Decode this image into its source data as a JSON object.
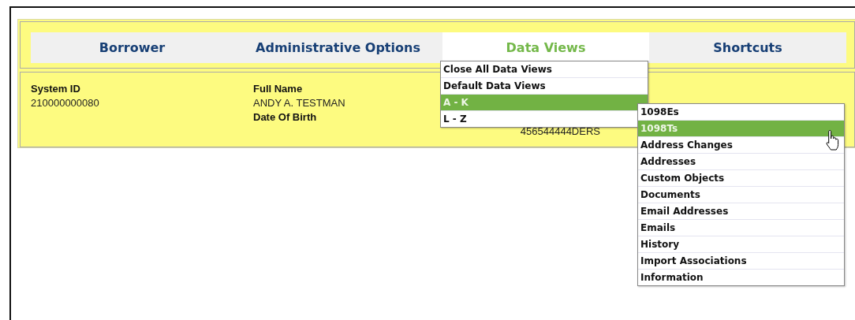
{
  "tabs": [
    {
      "label": "Borrower",
      "selected": false
    },
    {
      "label": "Administrative Options",
      "selected": false
    },
    {
      "label": "Data Views",
      "selected": true
    },
    {
      "label": "Shortcuts",
      "selected": false
    }
  ],
  "info_columns": [
    [
      {
        "kind": "label",
        "text": "System ID"
      },
      {
        "kind": "value",
        "text": "210000000080"
      }
    ],
    [
      {
        "kind": "label",
        "text": "Full Name"
      },
      {
        "kind": "value",
        "text": "ANDY A. TESTMAN"
      },
      {
        "kind": "label",
        "text": "Date Of Birth"
      }
    ],
    [
      {
        "kind": "value",
        "text": "456544444DERS"
      }
    ]
  ],
  "data_views_menu": [
    {
      "label": "Close All Data Views",
      "selected": false
    },
    {
      "label": "Default Data Views",
      "selected": false
    },
    {
      "label": "A - K",
      "selected": true
    },
    {
      "label": "L - Z",
      "selected": false
    }
  ],
  "submenu": [
    {
      "label": "1098Es",
      "selected": false
    },
    {
      "label": "1098Ts",
      "selected": true
    },
    {
      "label": "Address Changes",
      "selected": false
    },
    {
      "label": "Addresses",
      "selected": false
    },
    {
      "label": "Custom Objects",
      "selected": false
    },
    {
      "label": "Documents",
      "selected": false
    },
    {
      "label": "Email Addresses",
      "selected": false
    },
    {
      "label": "Emails",
      "selected": false
    },
    {
      "label": "History",
      "selected": false
    },
    {
      "label": "Import Associations",
      "selected": false
    },
    {
      "label": "Information",
      "selected": false
    }
  ]
}
